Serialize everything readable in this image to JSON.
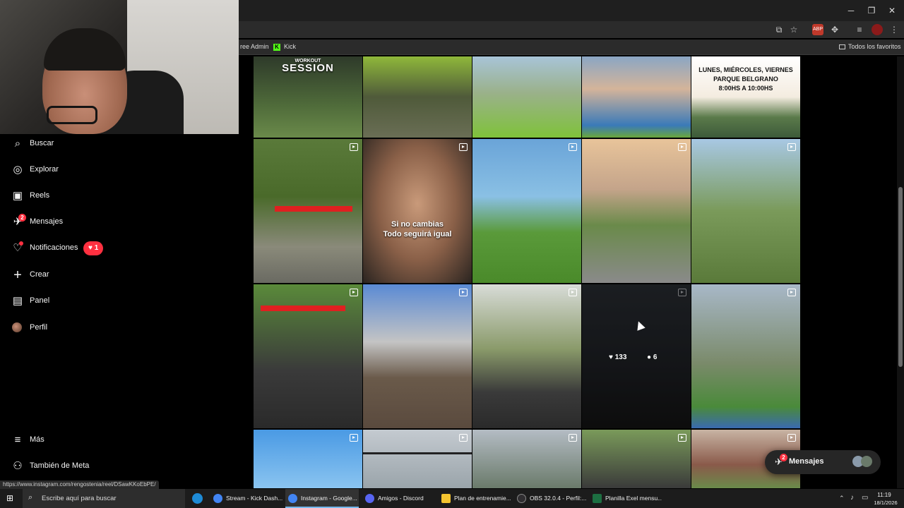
{
  "window": {
    "minimize": "─",
    "maximize": "❐",
    "close": "✕"
  },
  "bookmarks": {
    "item1": "ree Admin",
    "item2": "Kick",
    "all": "Todos los favoritos"
  },
  "sidebar": {
    "items": [
      {
        "label": "Buscar",
        "icon": "search-icon"
      },
      {
        "label": "Explorar",
        "icon": "compass-icon"
      },
      {
        "label": "Reels",
        "icon": "reels-icon"
      },
      {
        "label": "Mensajes",
        "icon": "messenger-icon",
        "badge": "2"
      },
      {
        "label": "Notificaciones",
        "icon": "heart-icon",
        "pill": "1"
      },
      {
        "label": "Crear",
        "icon": "plus-icon"
      },
      {
        "label": "Panel",
        "icon": "chart-icon"
      },
      {
        "label": "Perfil",
        "icon": "avatar"
      }
    ],
    "more": "Más",
    "meta": "También de Meta"
  },
  "grid": {
    "tile_0_0_text": "SESSION",
    "tile_0_0_small": "WORKOUT",
    "tile_0_4_lines": [
      "LUNES, MIÉRCOLES, VIERNES",
      "PARQUE BELGRANO",
      "8:00HS A 10:00HS"
    ],
    "tile_1_1_lines": [
      "Si no cambias",
      "Todo seguirá igual"
    ],
    "hover_likes": "133",
    "hover_comments": "6"
  },
  "floating_messages": {
    "label": "Mensajes",
    "badge": "2"
  },
  "status_url": "https://www.instagram.com/rengostenia/reel/DSawKKoEbPE/",
  "taskbar": {
    "search_placeholder": "Escribe aquí para buscar",
    "items": [
      {
        "label": "Stream - Kick Dash...",
        "color": "#4285f4"
      },
      {
        "label": "Instagram - Google...",
        "color": "#4285f4"
      },
      {
        "label": "Amigos - Discord",
        "color": "#5865f2"
      },
      {
        "label": "Plan de entrenamie...",
        "color": "#f4c430"
      },
      {
        "label": "OBS 32.0.4 - Perfil:...",
        "color": "#302e31"
      },
      {
        "label": "Planilla Exel mensu...",
        "color": "#1d6f42"
      }
    ],
    "time": "11:19",
    "date": "18/1/2026"
  }
}
